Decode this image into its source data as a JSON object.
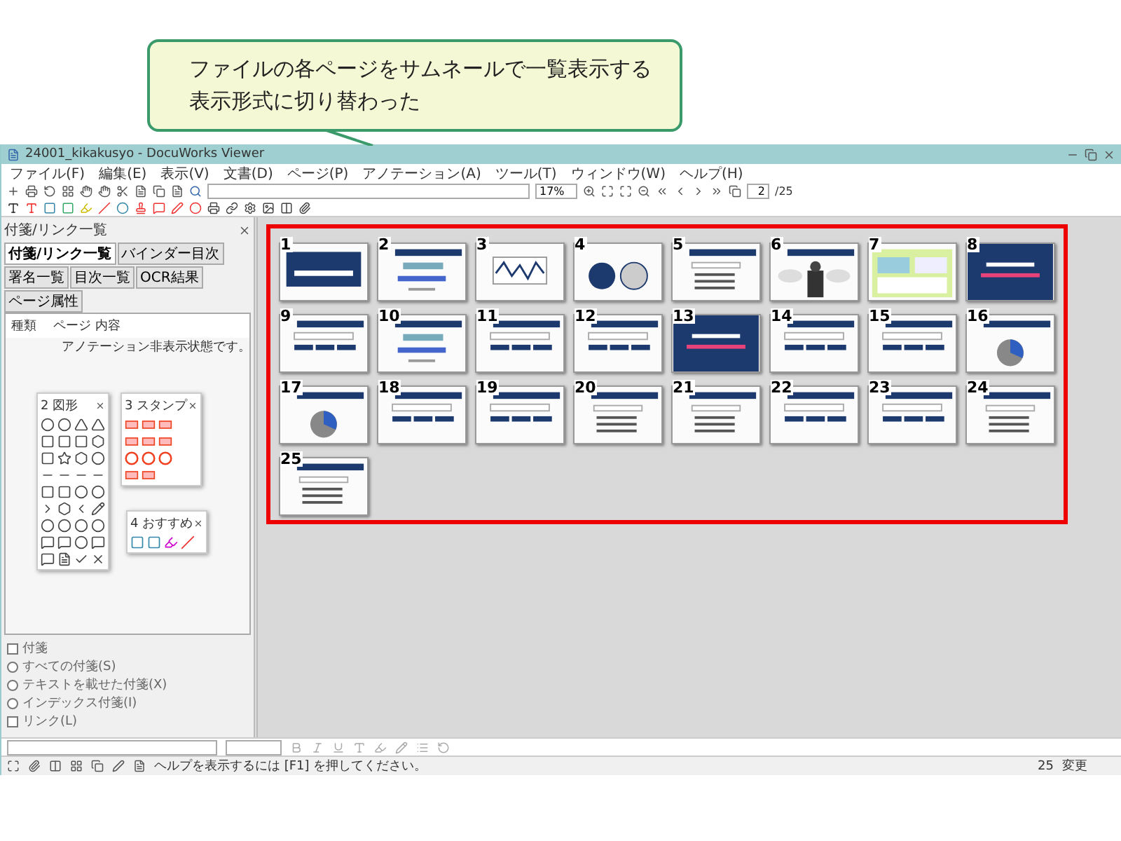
{
  "callout": {
    "lines": [
      "ファイルの各ページをサムネールで一覧表示する",
      "表示形式に切り替わった"
    ]
  },
  "window": {
    "title": "24001_kikakusyo - DocuWorks Viewer"
  },
  "menu": [
    "ファイル(F)",
    "編集(E)",
    "表示(V)",
    "文書(D)",
    "ページ(P)",
    "アノテーション(A)",
    "ツール(T)",
    "ウィンドウ(W)",
    "ヘルプ(H)"
  ],
  "toolbar": {
    "zoom": "17%",
    "page": "2",
    "page_total": "/25"
  },
  "side_panel": {
    "title": "付箋/リンク一覧",
    "tabs": [
      {
        "label": "付箋/リンク一覧",
        "selected": true
      },
      {
        "label": "バインダー目次",
        "selected": false
      },
      {
        "label": "署名一覧",
        "selected": false
      },
      {
        "label": "目次一覧",
        "selected": false
      },
      {
        "label": "OCR結果",
        "selected": false
      },
      {
        "label": "ページ属性",
        "selected": false
      }
    ],
    "columns": [
      "種類",
      "ページ",
      "内容"
    ],
    "message": "アノテーション非表示状態です。",
    "palettes": [
      {
        "title": "2 図形",
        "kind": "shapes"
      },
      {
        "title": "3 スタンプ",
        "kind": "stamps"
      },
      {
        "title": "4 おすすめ",
        "kind": "recommended"
      }
    ],
    "filters": [
      {
        "label": "付箋",
        "kind": "checkbox",
        "checked": false
      },
      {
        "label": "すべての付箋(S)",
        "kind": "radio",
        "selected": false
      },
      {
        "label": "テキストを載せた付箋(X)",
        "kind": "radio",
        "selected": false
      },
      {
        "label": "インデックス付箋(I)",
        "kind": "radio",
        "selected": false
      },
      {
        "label": "リンク(L)",
        "kind": "checkbox",
        "checked": false
      }
    ]
  },
  "thumbnails": [
    {
      "number": "1",
      "kind": "title"
    },
    {
      "number": "2",
      "kind": "text"
    },
    {
      "number": "3",
      "kind": "chart"
    },
    {
      "number": "4",
      "kind": "circles"
    },
    {
      "number": "5",
      "kind": "list"
    },
    {
      "number": "6"
    },
    {
      "number": "7",
      "kind": "collage"
    },
    {
      "number": "8",
      "kind": "dark"
    },
    {
      "number": "9",
      "kind": "banner"
    },
    {
      "number": "10",
      "kind": "text"
    },
    {
      "number": "11",
      "kind": "banner"
    },
    {
      "number": "12",
      "kind": "banner"
    },
    {
      "number": "13",
      "kind": "dark"
    },
    {
      "number": "14",
      "kind": "banner"
    },
    {
      "number": "15",
      "kind": "banner"
    },
    {
      "number": "16",
      "kind": "pie"
    },
    {
      "number": "17",
      "kind": "pie"
    },
    {
      "number": "18",
      "kind": "banner"
    },
    {
      "number": "19",
      "kind": "banner"
    },
    {
      "number": "20",
      "kind": "list"
    },
    {
      "number": "21",
      "kind": "list"
    },
    {
      "number": "22",
      "kind": "banner"
    },
    {
      "number": "23",
      "kind": "banner"
    },
    {
      "number": "24",
      "kind": "list"
    },
    {
      "number": "25",
      "kind": "list"
    }
  ],
  "status_bar": {
    "message": "ヘルプを表示するには [F1] を押してください。",
    "page_count": "25",
    "state": "変更"
  }
}
